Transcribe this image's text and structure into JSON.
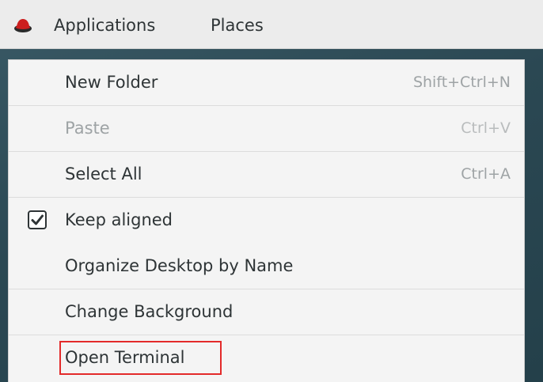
{
  "top_bar": {
    "logo_icon": "red-hat-logo-icon",
    "applications_label": "Applications",
    "places_label": "Places"
  },
  "context_menu": {
    "items": [
      {
        "label": "New Folder",
        "accelerator": "Shift+Ctrl+N",
        "enabled": true
      },
      {
        "label": "Paste",
        "accelerator": "Ctrl+V",
        "enabled": false
      },
      {
        "label": "Select All",
        "accelerator": "Ctrl+A",
        "enabled": true
      },
      {
        "label": "Keep aligned",
        "accelerator": "",
        "enabled": true,
        "checked": true
      },
      {
        "label": "Organize Desktop by Name",
        "accelerator": "",
        "enabled": true
      },
      {
        "label": "Change Background",
        "accelerator": "",
        "enabled": true
      },
      {
        "label": "Open Terminal",
        "accelerator": "",
        "enabled": true,
        "highlighted": true
      }
    ]
  },
  "colors": {
    "highlight_border": "#e32a2a",
    "menu_background": "#f4f4f4",
    "desktop_background": "#2e4a55"
  }
}
